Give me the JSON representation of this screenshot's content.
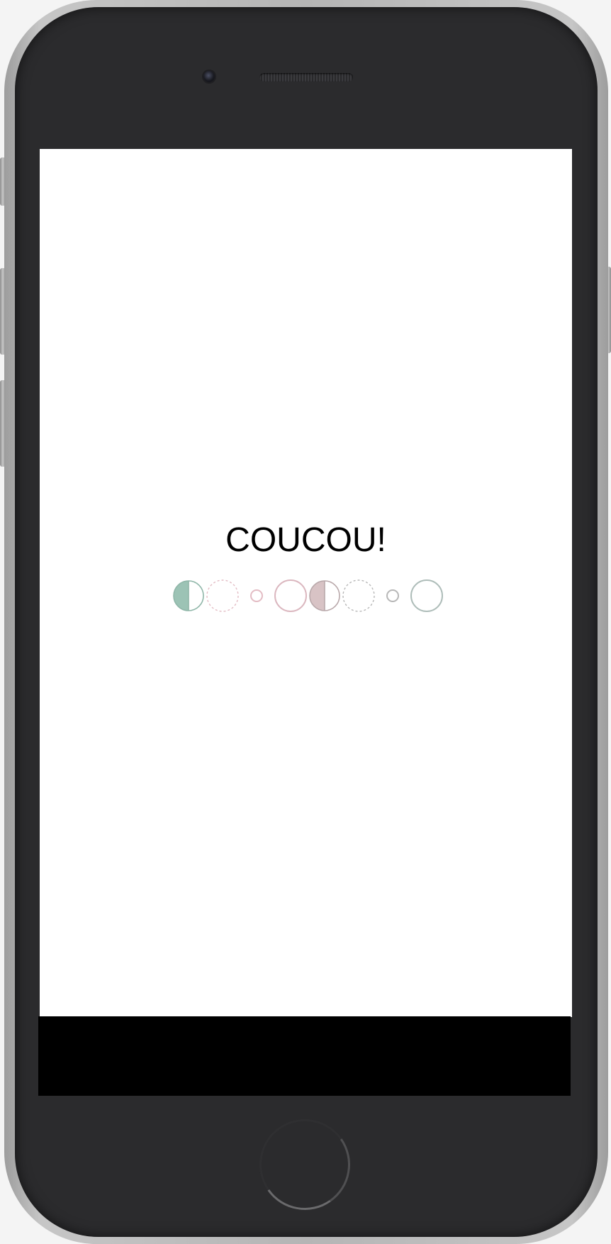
{
  "screen": {
    "title": "COUCOU!"
  },
  "loader": {
    "colors": {
      "green": "#9cc3b5",
      "green_stroke": "#8fb6a8",
      "pink": "#e3bcc4",
      "mauve": "#d8c3c5",
      "mauve_stroke": "#b9a8aa",
      "grey": "#b7b7b7",
      "grey_green": "#aebdb9"
    },
    "indicators": [
      "half-filled-circle-green",
      "dashed-circle-pink",
      "small-circle-pink",
      "circle-pink",
      "half-filled-circle-mauve",
      "dashed-circle-grey",
      "small-circle-grey",
      "circle-grey-green"
    ]
  },
  "device": {
    "frame_color": "#2b2b2d",
    "bezel_color": "#b5b5b5"
  }
}
